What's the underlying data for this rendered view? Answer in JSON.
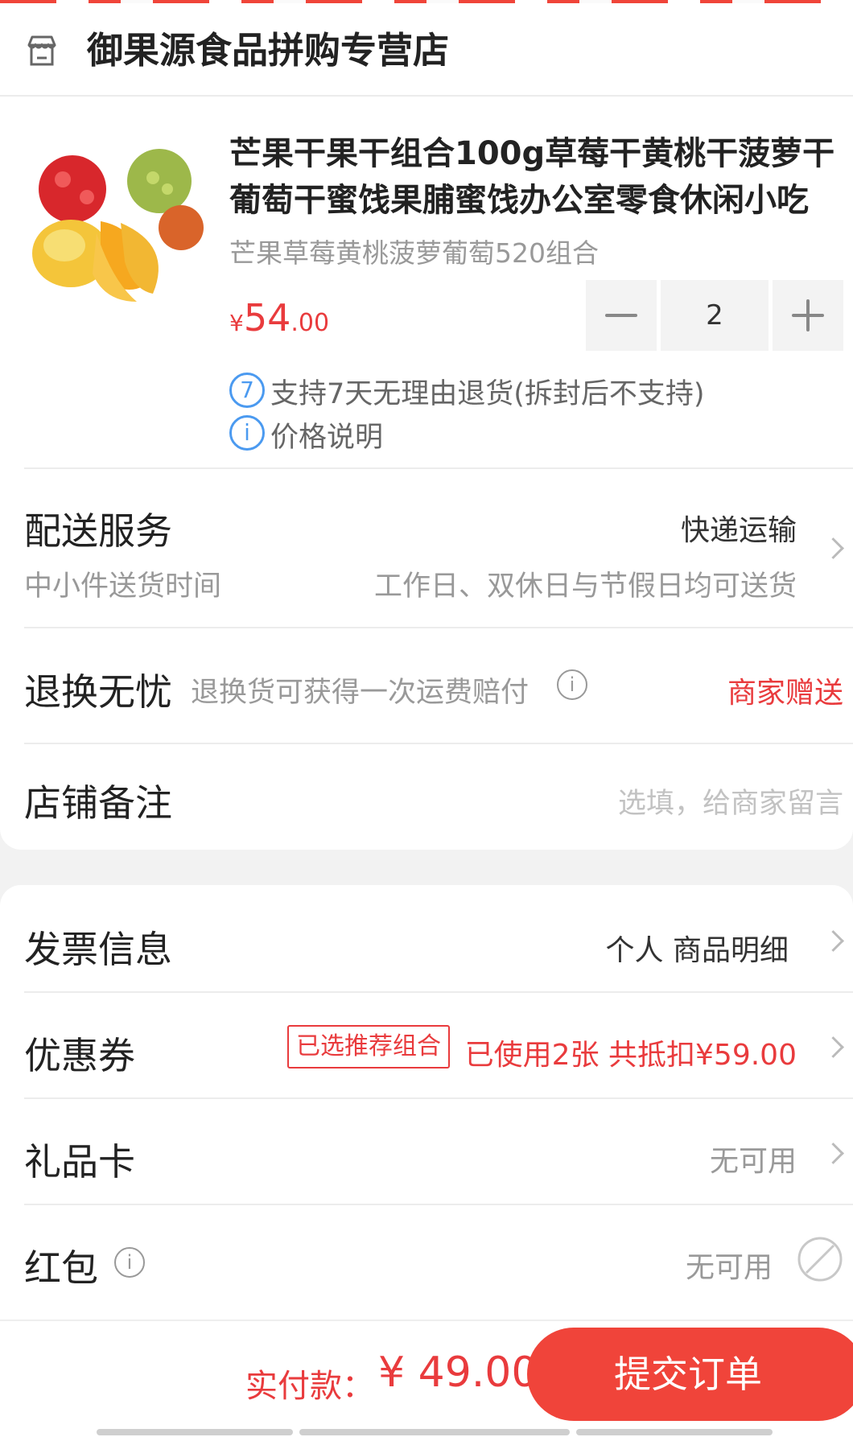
{
  "store": {
    "name": "御果源食品拼购专营店",
    "icon": "store-icon"
  },
  "product": {
    "title": "芒果干果干组合100g草莓干黄桃干菠萝干葡萄干蜜饯果脯蜜饯办公室零食休闲小吃",
    "spec": "芒果草莓黄桃菠萝葡萄520组合",
    "price_symbol": "¥",
    "price_int": "54",
    "price_dec": ".00",
    "quantity": "2",
    "return_policy": "支持7天无理由退货(拆封后不支持)",
    "return_policy_icon_text": "7",
    "price_note": "价格说明",
    "price_note_icon_text": "i"
  },
  "delivery": {
    "title": "配送服务",
    "method": "快递运输",
    "time_label": "中小件送货时间",
    "time_value": "工作日、双休日与节假日均可送货"
  },
  "return_insurance": {
    "title": "退换无忧",
    "desc": "退换货可获得一次运费赔付",
    "value": "商家赠送"
  },
  "store_note": {
    "title": "店铺备注",
    "placeholder": "选填，给商家留言"
  },
  "invoice": {
    "title": "发票信息",
    "value": "个人 商品明细"
  },
  "coupon": {
    "title": "优惠券",
    "badge": "已选推荐组合",
    "value": "已使用2张 共抵扣¥59.00"
  },
  "gift_card": {
    "title": "礼品卡",
    "value": "无可用"
  },
  "red_packet": {
    "title": "红包",
    "value": "无可用"
  },
  "footer": {
    "pay_label": "实付款：",
    "pay_amount": "¥ 49.00",
    "submit_label": "提交订单"
  },
  "colors": {
    "accent": "#e93b3d",
    "button": "#f0443a",
    "info_blue": "#4b9af0"
  }
}
